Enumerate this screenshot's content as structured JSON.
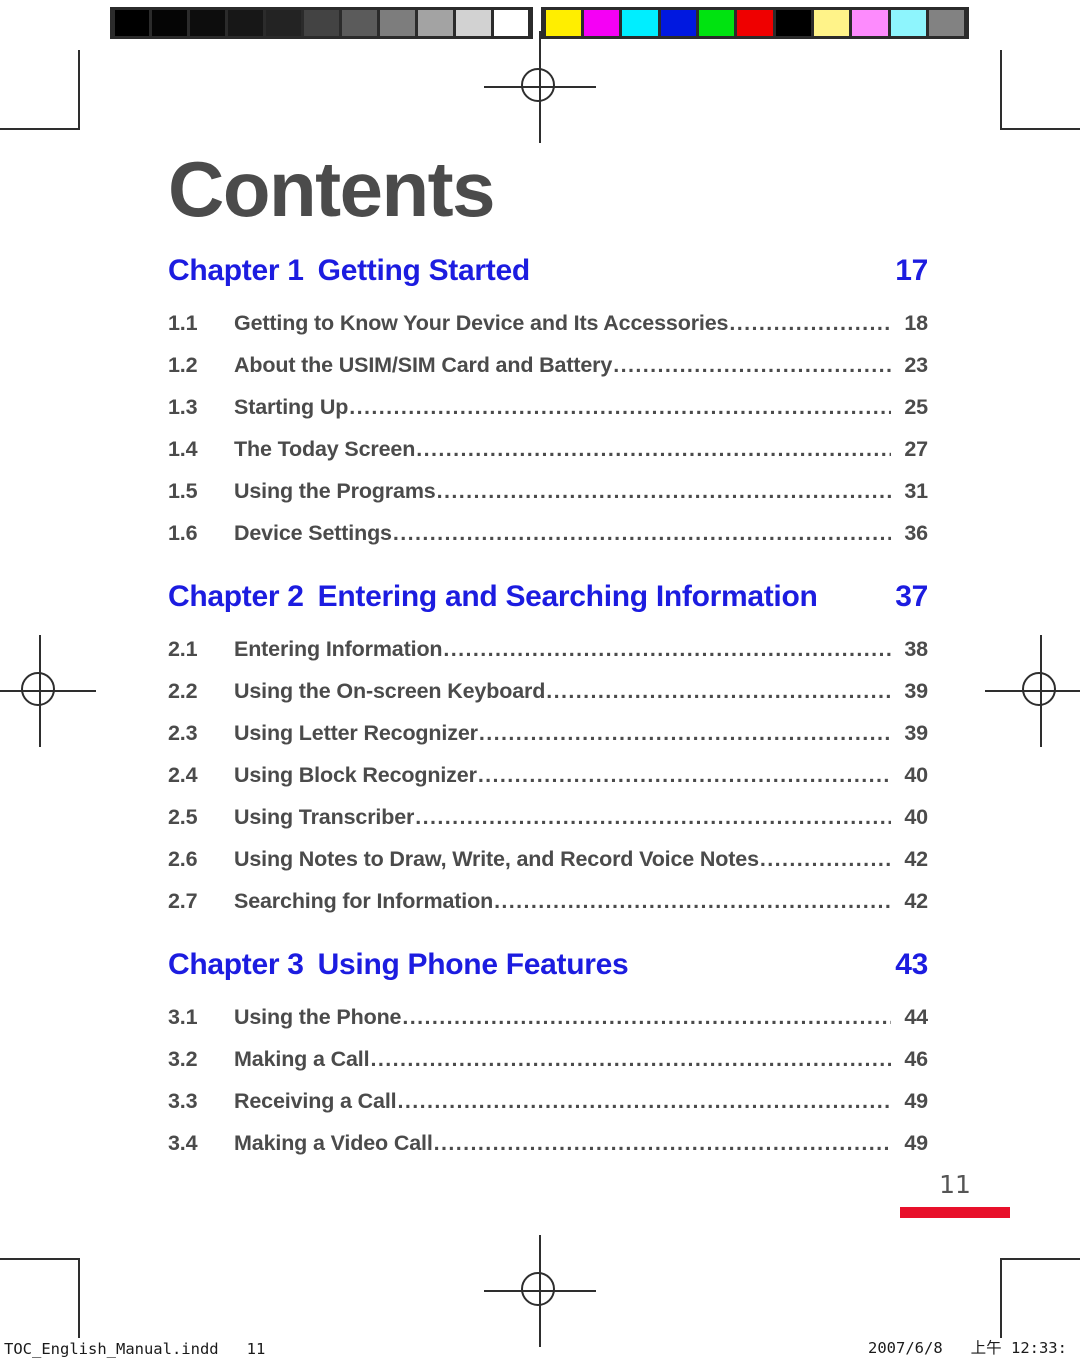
{
  "document": {
    "title": "Contents",
    "folio_number": "11",
    "folio_rule_color": "#e8102a",
    "heading_color": "#1c1ce0",
    "body_color": "#4b4b4b"
  },
  "calibration": {
    "grayscale_patches": [
      "#000000",
      "#050505",
      "#0d0d0d",
      "#171717",
      "#232323",
      "#434343",
      "#5b5b5b",
      "#7d7d7d",
      "#a3a3a3",
      "#d2d2d2",
      "#ffffff"
    ],
    "color_patches": [
      "#ffee00",
      "#f500f5",
      "#00eeff",
      "#0018e0",
      "#00e310",
      "#ef0000",
      "#000000",
      "#fff389",
      "#fd8bfd",
      "#8ef5fd",
      "#828282"
    ]
  },
  "chapters": [
    {
      "label": "Chapter 1",
      "title": "Getting Started",
      "page": "17",
      "sections": [
        {
          "num": "1.1",
          "name": "Getting to Know Your Device and Its Accessories",
          "page": "18"
        },
        {
          "num": "1.2",
          "name": "About the USIM/SIM Card and Battery",
          "page": "23"
        },
        {
          "num": "1.3",
          "name": "Starting Up",
          "page": "25"
        },
        {
          "num": "1.4",
          "name": "The Today Screen",
          "page": "27"
        },
        {
          "num": "1.5",
          "name": "Using the Programs",
          "page": "31"
        },
        {
          "num": "1.6",
          "name": "Device Settings",
          "page": "36"
        }
      ]
    },
    {
      "label": "Chapter 2",
      "title": "Entering and Searching Information",
      "page": "37",
      "sections": [
        {
          "num": "2.1",
          "name": "Entering Information",
          "page": "38"
        },
        {
          "num": "2.2",
          "name": "Using the On-screen Keyboard",
          "page": "39"
        },
        {
          "num": "2.3",
          "name": "Using Letter Recognizer",
          "page": "39"
        },
        {
          "num": "2.4",
          "name": "Using Block Recognizer",
          "page": "40"
        },
        {
          "num": "2.5",
          "name": "Using Transcriber",
          "page": "40"
        },
        {
          "num": "2.6",
          "name": "Using Notes to Draw, Write, and Record Voice Notes",
          "page": "42"
        },
        {
          "num": "2.7",
          "name": "Searching for Information",
          "page": "42"
        }
      ]
    },
    {
      "label": "Chapter 3",
      "title": "Using Phone Features",
      "page": "43",
      "sections": [
        {
          "num": "3.1",
          "name": "Using the Phone",
          "page": "44"
        },
        {
          "num": "3.2",
          "name": "Making a Call",
          "page": "46"
        },
        {
          "num": "3.3",
          "name": "Receiving a Call",
          "page": "49"
        },
        {
          "num": "3.4",
          "name": "Making a Video Call",
          "page": "49"
        }
      ]
    }
  ],
  "footer_slug": {
    "left": "TOC_English_Manual.indd   11",
    "right": "2007/6/8   上午 12:33:"
  }
}
